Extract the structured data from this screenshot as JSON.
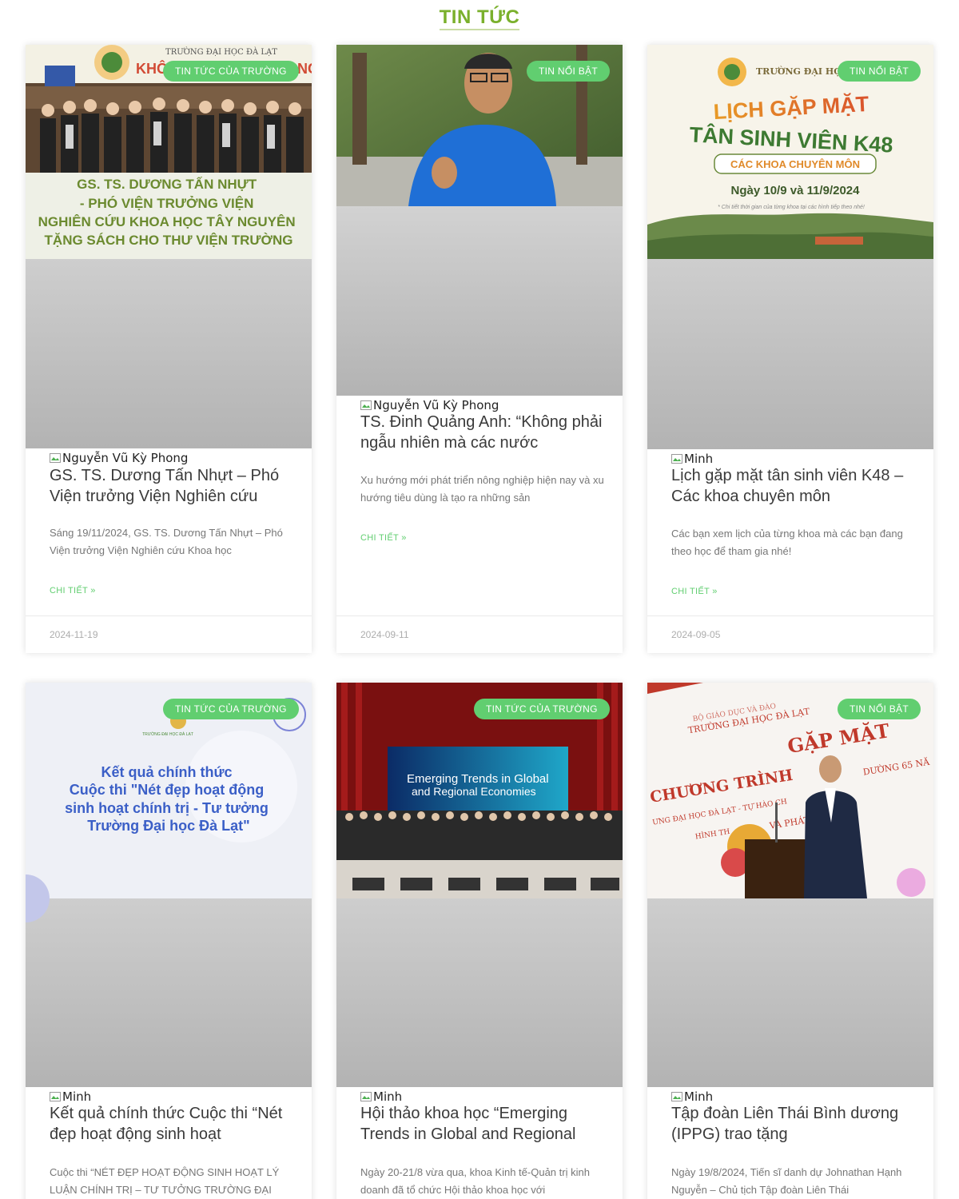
{
  "section": {
    "title": "TIN TỨC"
  },
  "posts": [
    {
      "badge": "TIN TỨC CỦA TRƯỜNG",
      "author": "Nguyễn Vũ Kỳ Phong",
      "title": "GS. TS. Dương Tấn Nhựt – Phó Viện trưởng Viện Nghiên cứu Khoa học Tây Nguyên tặng sách cho Thư viện Trường",
      "excerpt": "Sáng 19/11/2024, GS. TS. Dương Tấn Nhựt – Phó Viện trưởng Viện Nghiên cứu Khoa học",
      "read_more": "CHI TIẾT »",
      "date": "2024-11-19",
      "image": {
        "header": "TRƯỜNG ĐẠI HỌC ĐÀ LẠT",
        "banner_partial": "KHÔ",
        "banner_partial_right": "NG",
        "caption": [
          "GS. TS. DƯƠNG TẤN NHỰT",
          "- PHÓ VIỆN TRƯỞNG VIỆN",
          "NGHIÊN CỨU KHOA HỌC TÂY NGUYÊN",
          "TẶNG SÁCH CHO THƯ VIỆN TRƯỜNG"
        ]
      }
    },
    {
      "badge": "TIN NỔI BẬT",
      "author": "Nguyễn Vũ Kỳ Phong",
      "title": "TS. Đinh Quảng Anh: “Không phải ngẫu nhiên mà các nước",
      "excerpt": "Xu hướng mới phát triển nông nghiệp hiện nay và xu hướng tiêu dùng là tạo ra những sản",
      "read_more": "CHI TIẾT »",
      "date": "2024-09-11"
    },
    {
      "badge": "TIN NỔI BẬT",
      "author": "Minh",
      "title": "Lịch gặp mặt tân sinh viên K48 – Các khoa chuyên môn",
      "excerpt": "Các bạn xem lịch của từng khoa mà các bạn đang theo học để tham gia nhé!",
      "read_more": "CHI TIẾT »",
      "date": "2024-09-05",
      "image": {
        "header": "TRƯỜNG ĐẠI HỌC Đ",
        "line1": "LỊCH GẶP MẶT",
        "line2": "TÂN SINH VIÊN K48",
        "pill": "CÁC KHOA CHUYÊN MÔN",
        "dates": "Ngày 10/9 và 11/9/2024",
        "note": "* Chi tiết thời gian của từng khoa tại các hình tiếp theo nhé!"
      }
    },
    {
      "badge": "TIN TỨC CỦA TRƯỜNG",
      "author": "Minh",
      "title": "Kết quả chính thức Cuộc thi “Nét đẹp hoạt động sinh hoạt",
      "excerpt": "Cuộc thi “NÉT ĐẸP HOẠT ĐỘNG SINH HOẠT LÝ LUẬN CHÍNH TRỊ – TƯ TƯỞNG TRƯỜNG ĐẠI",
      "image": {
        "logo_text": "TRƯỜNG ĐẠI HỌC ĐÀ LẠT",
        "lines": [
          "Kết quả chính thức",
          "Cuộc thi \"Nét đẹp hoạt động",
          "sinh hoạt chính trị - Tư tưởng",
          "Trường Đại học Đà Lạt\""
        ]
      }
    },
    {
      "badge": "TIN TỨC CỦA TRƯỜNG",
      "author": "Minh",
      "title": "Hội thảo khoa học “Emerging Trends in Global and Regional",
      "excerpt": "Ngày 20-21/8 vừa qua, khoa Kinh tế-Quản trị kinh doanh đã tổ chức Hội thảo khoa học với",
      "image": {
        "screen_line1": "Emerging Trends in Global",
        "screen_line2": "and Regional Economies"
      }
    },
    {
      "badge": "TIN NỔI BẬT",
      "author": "Minh",
      "title": "Tập đoàn Liên Thái Bình dương (IPPG) trao tặng",
      "excerpt": "Ngày 19/8/2024, Tiến sĩ danh dự Johnathan Hạnh Nguyễn – Chủ tịch Tập đoàn Liên Thái",
      "image": {
        "top1": "BỘ GIÁO DỤC VÀ ĐÀO",
        "top2": "TRƯỜNG ĐẠI HỌC ĐÀ LẠT",
        "line1": "GẶP MẶT",
        "line2": "CHƯƠNG TRÌNH",
        "line3": "DƯỜNG 65 NĂ",
        "line4": "ƯNG ĐẠI HỌC ĐÀ LẠT - TỰ HÀO CH",
        "line5": "HÌNH TH",
        "line6": "VÀ PHÁT",
        "line7": "N"
      }
    }
  ],
  "colors": {
    "accent_green": "#61ce70",
    "title_green": "#7ab02c"
  },
  "icons": {
    "broken_image": "broken-image-icon"
  }
}
